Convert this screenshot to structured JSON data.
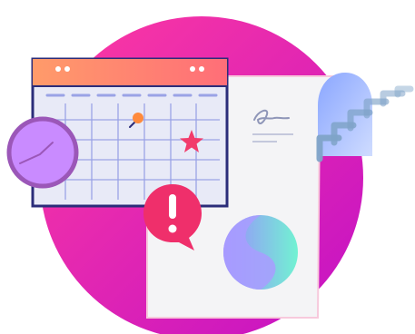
{
  "illustration": {
    "colors": {
      "background_circle_start": "#ff3aa0",
      "background_circle_end": "#c211c6",
      "calendar_header_start": "#ff9b6a",
      "calendar_header_end": "#ff6e78",
      "calendar_body": "#e8eaf7",
      "calendar_border": "#2b2d7a",
      "calendar_grid": "#9aa3e6",
      "star": "#f23b6b",
      "pin": "#ff8a3c",
      "clock_face": "#c98bff",
      "clock_ring": "#9b57b8",
      "alert_bubble": "#ef2f6b",
      "document_paper": "#f4f4f6",
      "document_stroke": "#f7c9dc",
      "seal_start": "#9b8cff",
      "seal_end": "#71f2d2",
      "cloud_start": "#8aa6ff",
      "cloud_end": "#cfdcff",
      "wifi_waves": "#7fa3c8"
    },
    "icons": [
      "calendar-icon",
      "clock-icon",
      "alert-icon",
      "document-icon",
      "signature-icon",
      "star-icon",
      "pin-icon",
      "seal-icon",
      "cloud-icon",
      "wifi-waves-icon"
    ]
  }
}
